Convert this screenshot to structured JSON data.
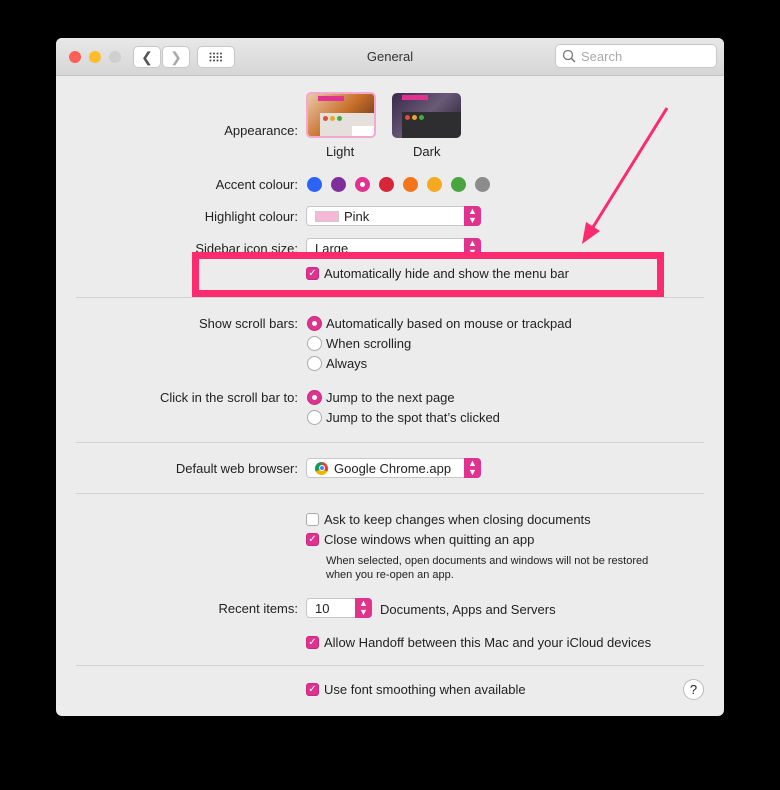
{
  "window": {
    "title": "General",
    "search_placeholder": "Search"
  },
  "appearance": {
    "label": "Appearance:",
    "options": [
      {
        "label": "Light",
        "selected": true
      },
      {
        "label": "Dark",
        "selected": false
      }
    ]
  },
  "accent": {
    "label": "Accent colour:",
    "colors": [
      "#2b63f5",
      "#7f2f99",
      "#e0338f",
      "#d7263a",
      "#f4761c",
      "#f5a91f",
      "#4aa43f",
      "#8c8c8c"
    ],
    "selected": 2
  },
  "highlight": {
    "label": "Highlight colour:",
    "value": "Pink",
    "swatch": "#f6b8d9"
  },
  "sidebar": {
    "label": "Sidebar icon size:",
    "value": "Large"
  },
  "menubar": {
    "label": "Automatically hide and show the menu bar",
    "checked": true
  },
  "scrollbars": {
    "label": "Show scroll bars:",
    "options": [
      "Automatically based on mouse or trackpad",
      "When scrolling",
      "Always"
    ],
    "selected": 0
  },
  "click_scroll": {
    "label": "Click in the scroll bar to:",
    "options": [
      "Jump to the next page",
      "Jump to the spot that’s clicked"
    ],
    "selected": 0
  },
  "browser": {
    "label": "Default web browser:",
    "value": "Google Chrome.app"
  },
  "docs": {
    "ask_label": "Ask to keep changes when closing documents",
    "ask_checked": false,
    "close_label": "Close windows when quitting an app",
    "close_checked": true,
    "note_line1": "When selected, open documents and windows will not be restored",
    "note_line2": "when you re-open an app."
  },
  "recent": {
    "label": "Recent items:",
    "value": "10",
    "suffix": "Documents, Apps and Servers"
  },
  "handoff": {
    "label": "Allow Handoff between this Mac and your iCloud devices",
    "checked": true
  },
  "smoothing": {
    "label": "Use font smoothing when available",
    "checked": true
  },
  "help": {
    "label": "?"
  },
  "annotation_color": "#fc2a6e",
  "accent_color": "#e0338f"
}
